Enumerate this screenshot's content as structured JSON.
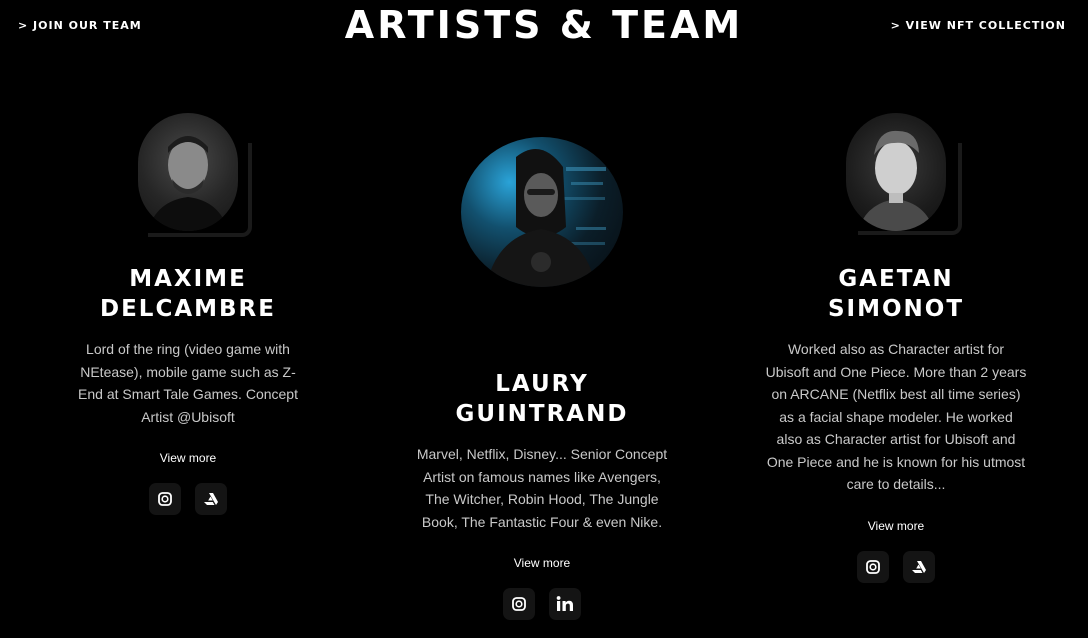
{
  "header": {
    "join_link": "> Join our team",
    "title": "ARTISTS & TEAM",
    "nft_link": "> View NFT collection"
  },
  "artists": [
    {
      "name_line1": "MAXIME",
      "name_line2": "DELCAMBRE",
      "description": "Lord of the ring (video game with NEtease), mobile game such as Z-End at Smart Tale Games. Concept Artist @Ubisoft",
      "view_more": "View more",
      "socials": [
        "instagram-icon",
        "artstation-icon"
      ]
    },
    {
      "name_line1": "LAURY",
      "name_line2": "GUINTRAND",
      "description": "Marvel, Netflix, Disney... Senior Concept Artist on famous names like Avengers, The Witcher, Robin Hood, The Jungle Book, The Fantastic Four & even Nike.",
      "view_more": "View more",
      "socials": [
        "instagram-icon",
        "linkedin-icon"
      ]
    },
    {
      "name_line1": "GAETAN",
      "name_line2": "SIMONOT",
      "description": "Worked also as Character artist for Ubisoft and One Piece. More than 2 years on ARCANE (Netflix best all time series) as a facial shape modeler. He worked also as Character artist for Ubisoft and One Piece and he is known for his utmost care to details...",
      "view_more": "View more",
      "socials": [
        "instagram-icon",
        "artstation-icon"
      ]
    }
  ],
  "colors": {
    "background": "#000000",
    "text": "#ffffff",
    "muted_text": "#c9c9c9",
    "accent_blue": "#2aa3d8"
  }
}
